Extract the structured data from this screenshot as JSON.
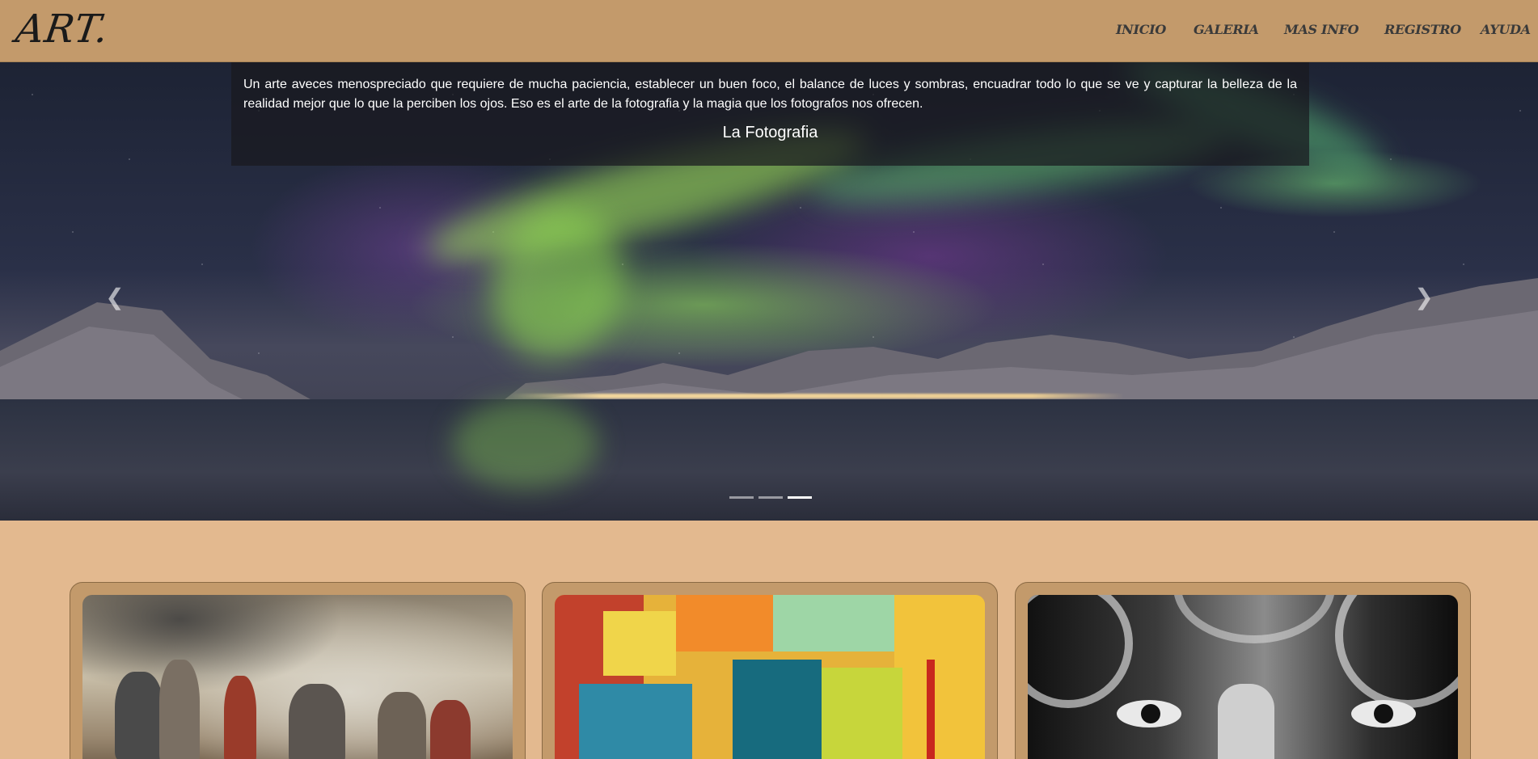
{
  "navbar": {
    "brand": "ART.",
    "links": [
      "INICIO",
      "GALERIA",
      "MAS INFO",
      "REGISTRO",
      "AYUDA"
    ]
  },
  "carousel": {
    "caption_text": "Un arte aveces menospreciado que requiere de mucha paciencia, establecer un buen foco, el balance de luces y sombras, encuadrar todo lo que se ve y capturar la belleza de la realidad mejor que lo que la perciben los ojos. Eso es el arte de la fotografia y la magia que los fotografos nos ofrecen.",
    "caption_title": "La Fotografia",
    "prev_icon": "chevron-left-icon",
    "next_icon": "chevron-right-icon",
    "indicator_count": 3,
    "active_indicator": 3
  },
  "colors": {
    "page_background": "#e3b98f",
    "navbar_background": "#c39a6b",
    "card_background": "#c39a6b"
  }
}
